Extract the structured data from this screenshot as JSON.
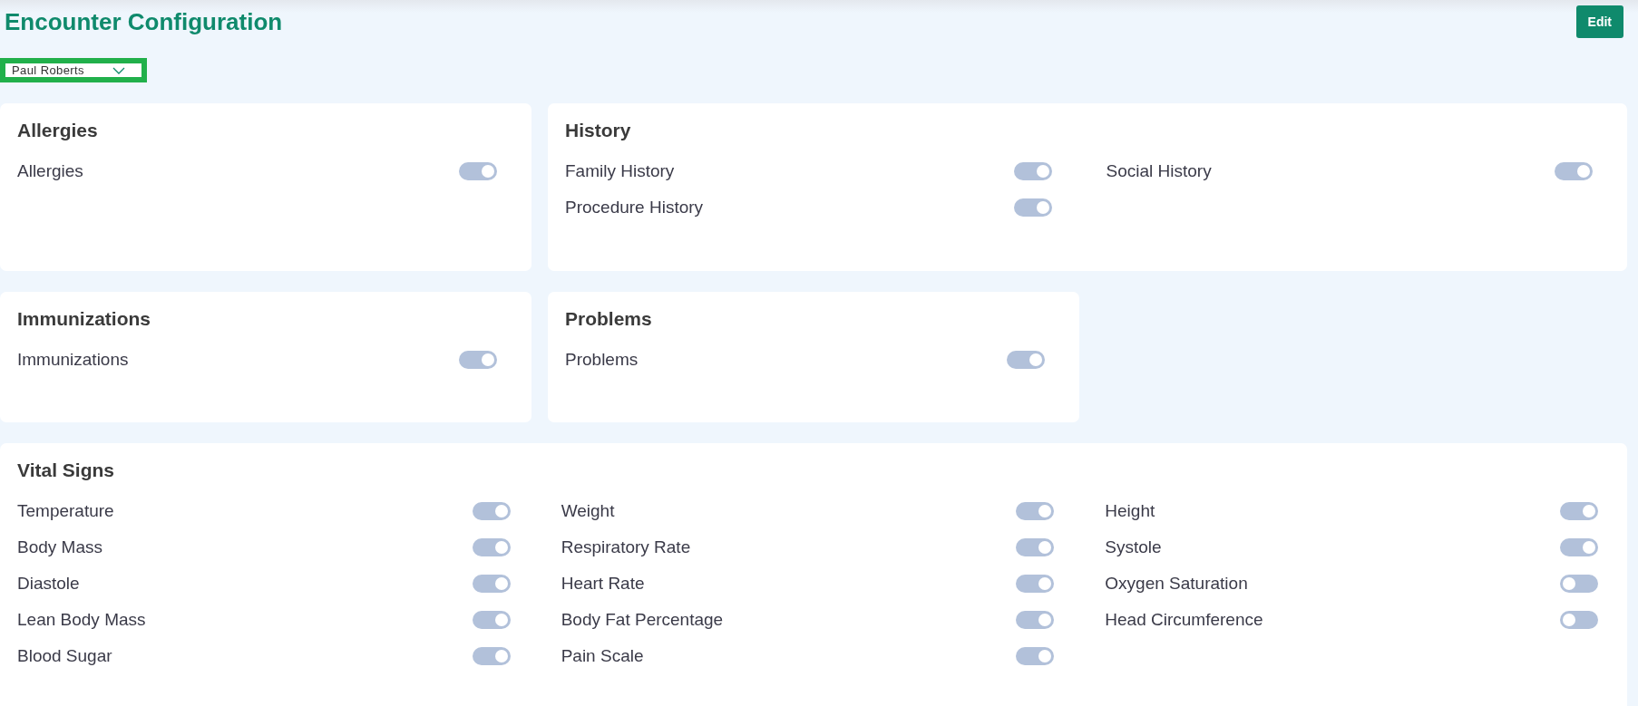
{
  "title": "Encounter Configuration",
  "edit_button": "Edit",
  "patient_select": {
    "value": "Paul Roberts"
  },
  "rows": [
    {
      "cards": [
        {
          "title": "Allergies",
          "columns": [
            [
              {
                "label": "Allergies",
                "on": true
              }
            ]
          ]
        },
        {
          "title": "History",
          "columns": [
            [
              {
                "label": "Family History",
                "on": true
              },
              {
                "label": "Procedure History",
                "on": true
              }
            ],
            [
              {
                "label": "Social History",
                "on": true
              }
            ]
          ]
        }
      ]
    },
    {
      "cards": [
        {
          "title": "Immunizations",
          "columns": [
            [
              {
                "label": "Immunizations",
                "on": true
              }
            ]
          ]
        },
        {
          "title": "Problems",
          "columns": [
            [
              {
                "label": "Problems",
                "on": true
              }
            ]
          ]
        }
      ]
    },
    {
      "cards": [
        {
          "title": "Vital Signs",
          "columns": [
            [
              {
                "label": "Temperature",
                "on": true
              },
              {
                "label": "Body Mass",
                "on": true
              },
              {
                "label": "Diastole",
                "on": true
              },
              {
                "label": "Lean Body Mass",
                "on": true
              },
              {
                "label": "Blood Sugar",
                "on": true
              }
            ],
            [
              {
                "label": "Weight",
                "on": true
              },
              {
                "label": "Respiratory Rate",
                "on": true
              },
              {
                "label": "Heart Rate",
                "on": true
              },
              {
                "label": "Body Fat Percentage",
                "on": true
              },
              {
                "label": "Pain Scale",
                "on": true
              }
            ],
            [
              {
                "label": "Height",
                "on": true
              },
              {
                "label": "Systole",
                "on": true
              },
              {
                "label": "Oxygen Saturation",
                "on": false
              },
              {
                "label": "Head Circumference",
                "on": false
              }
            ]
          ]
        }
      ]
    }
  ]
}
